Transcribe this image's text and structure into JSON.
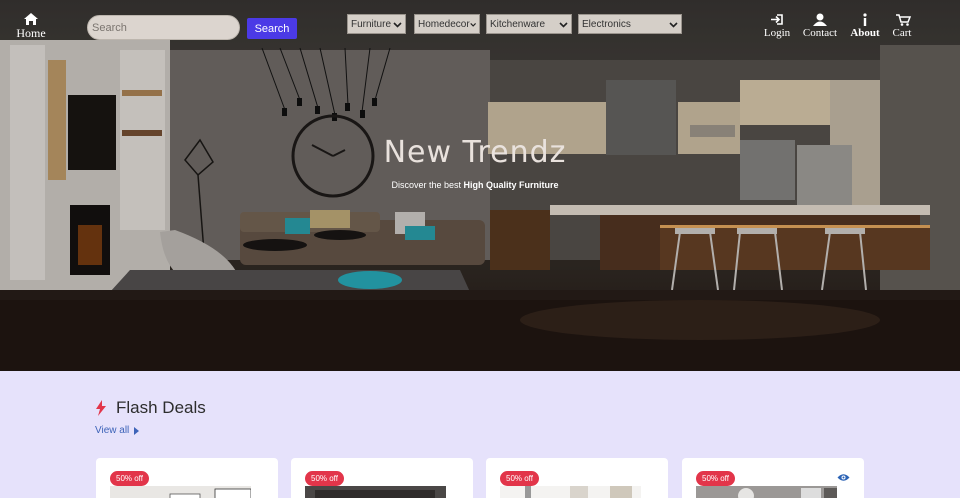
{
  "nav": {
    "home_label": "Home",
    "search_placeholder": "Search",
    "search_button": "Search",
    "categories": [
      {
        "selected": "Furniture"
      },
      {
        "selected": "Homedecor"
      },
      {
        "selected": "Kitchenware"
      },
      {
        "selected": "Electronics"
      }
    ],
    "right": [
      {
        "label": "Login",
        "icon": "login-icon"
      },
      {
        "label": "Contact",
        "icon": "user-icon"
      },
      {
        "label": "About",
        "icon": "info-icon"
      },
      {
        "label": "Cart",
        "icon": "cart-icon"
      }
    ]
  },
  "hero": {
    "title": "New Trendz",
    "subtitle_prefix": "Discover the best",
    "subtitle_bold": "High Quality Furniture"
  },
  "flash": {
    "title": "Flash Deals",
    "view_all": "View all",
    "icon": "bolt-icon",
    "accent": "#e2354a",
    "cards": [
      {
        "badge": "50% off"
      },
      {
        "badge": "50% off"
      },
      {
        "badge": "50% off"
      },
      {
        "badge": "50% off",
        "action_icon": "eye-icon"
      }
    ]
  },
  "colors": {
    "page_bg": "#e6e2fb",
    "search_button": "#4b3ae6",
    "link": "#3d63b8"
  }
}
